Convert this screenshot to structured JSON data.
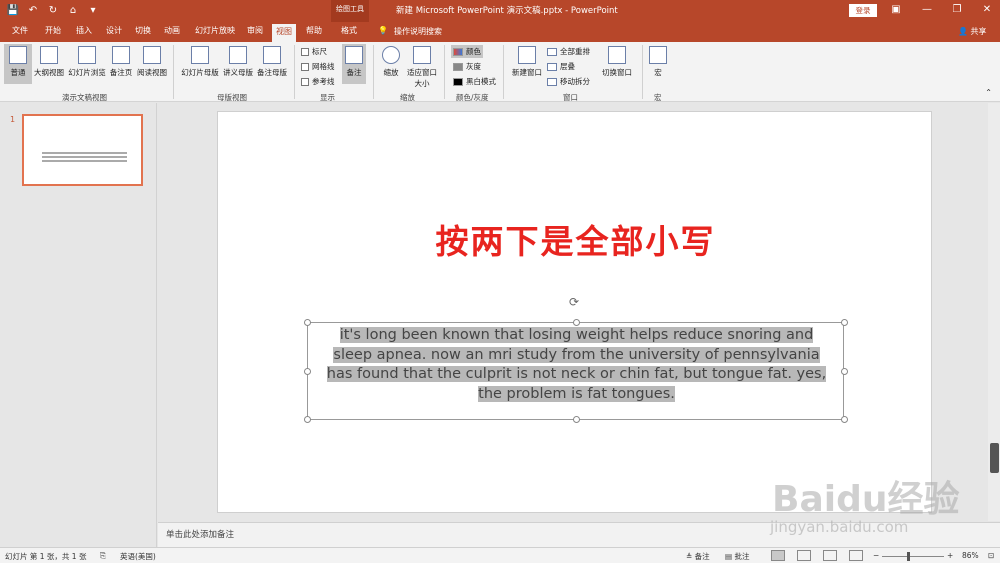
{
  "titlebar": {
    "title": "新建 Microsoft PowerPoint 演示文稿.pptx - PowerPoint",
    "context_tool": "绘图工具",
    "login": "登录"
  },
  "tabs": [
    {
      "label": "文件"
    },
    {
      "label": "开始"
    },
    {
      "label": "插入"
    },
    {
      "label": "设计"
    },
    {
      "label": "切换"
    },
    {
      "label": "动画"
    },
    {
      "label": "幻灯片放映"
    },
    {
      "label": "审阅"
    },
    {
      "label": "视图"
    },
    {
      "label": "帮助"
    },
    {
      "label": "格式"
    }
  ],
  "tellme": "操作说明搜索",
  "share": "共享",
  "ribbon": {
    "views": [
      "普通",
      "大纲视图",
      "幻灯片浏览",
      "备注页",
      "阅读视图"
    ],
    "views_group": "演示文稿视图",
    "masters": [
      "幻灯片母版",
      "讲义母版",
      "备注母版"
    ],
    "masters_group": "母版视图",
    "show": [
      "标尺",
      "网格线",
      "参考线"
    ],
    "notes": "备注",
    "show_group": "显示",
    "zoom": "缩放",
    "fit": "适应窗口大小",
    "zoom_group": "缩放",
    "color": "颜色",
    "gray": "灰度",
    "bw": "黑白模式",
    "color_group": "颜色/灰度",
    "new_window": "新建窗口",
    "arrange_all": "全部重排",
    "cascade": "层叠",
    "move_split": "移动拆分",
    "switch_window": "切换窗口",
    "window_group": "窗口",
    "macro": "宏",
    "macro_group": "宏"
  },
  "slide": {
    "number": "1",
    "title": "按两下是全部小写",
    "body_lines": [
      "it's long been known that losing weight helps reduce snoring and",
      "sleep apnea. now an mri study from the university of pennsylvania",
      "has found that the culprit is not neck or chin fat, but tongue fat. yes,",
      "the problem is fat tongues."
    ]
  },
  "notes_placeholder": "单击此处添加备注",
  "status": {
    "slide_info": "幻灯片 第 1 张，共 1 张",
    "language": "英语(美国)",
    "notes": "备注",
    "comments": "批注",
    "zoom": "86%"
  },
  "watermark": {
    "text": "Baidu经验",
    "sub": "jingyan.baidu.com"
  },
  "colors": {
    "accent": "#b7472a",
    "title_red": "#e8241f"
  }
}
